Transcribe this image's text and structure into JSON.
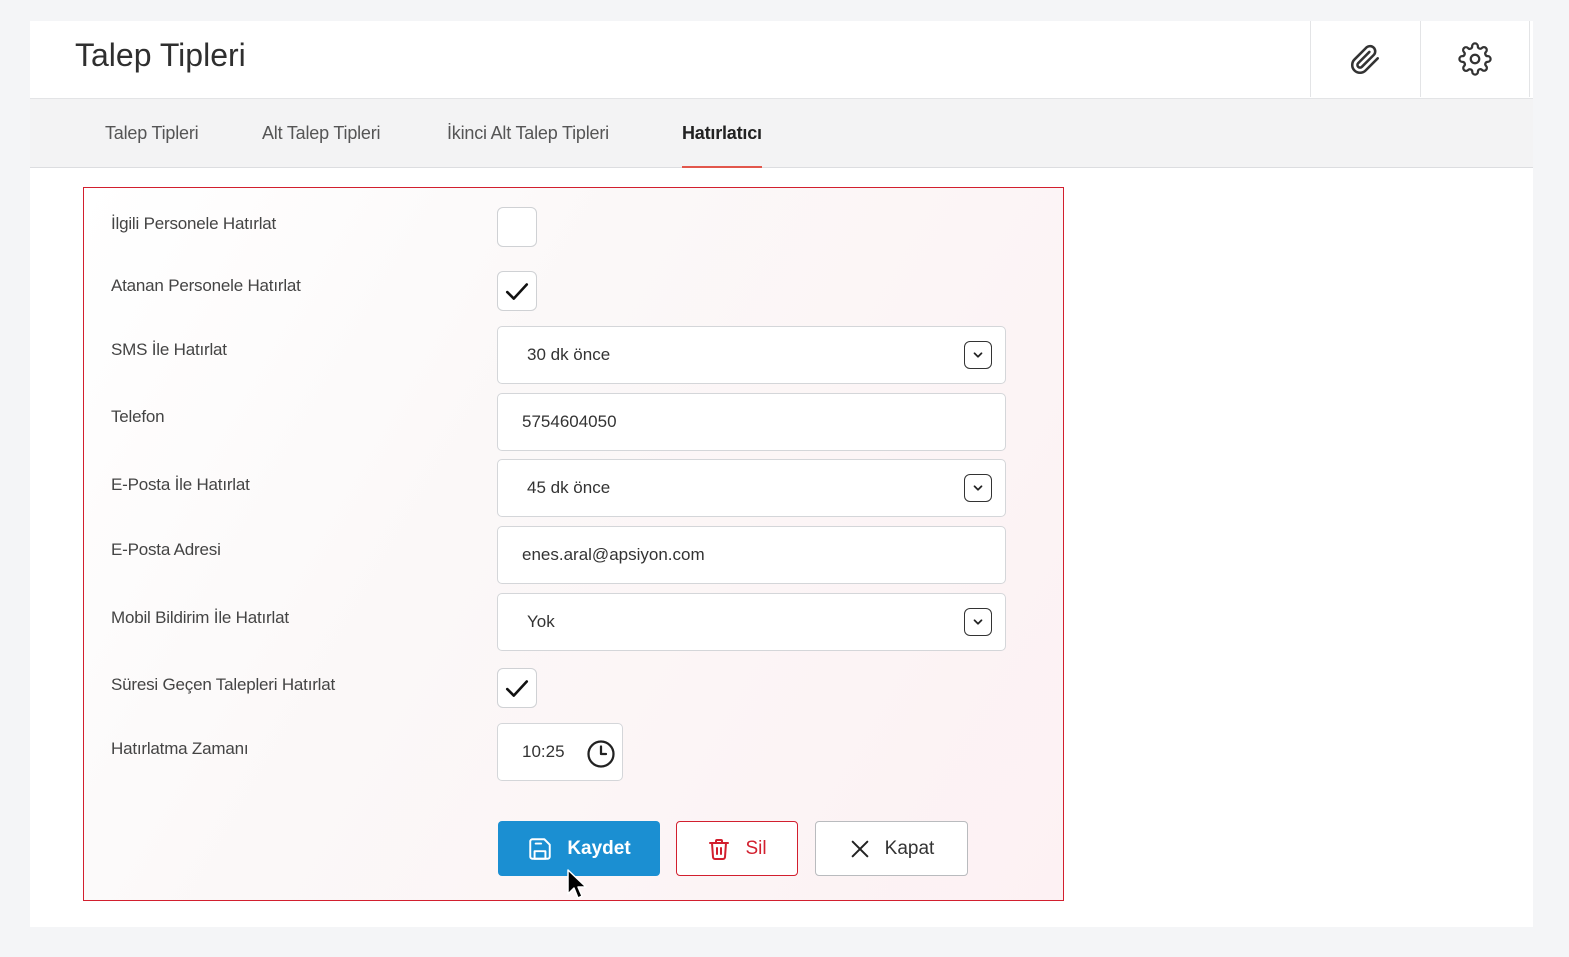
{
  "header": {
    "title": "Talep Tipleri",
    "attach_icon": "paperclip-icon",
    "settings_icon": "gear-icon"
  },
  "tabs": [
    {
      "label": "Talep Tipleri",
      "active": false
    },
    {
      "label": "Alt Talep Tipleri",
      "active": false
    },
    {
      "label": "İkinci Alt Talep Tipleri",
      "active": false
    },
    {
      "label": "Hatırlatıcı",
      "active": true
    }
  ],
  "form": {
    "related_staff": {
      "label": "İlgili Personele Hatırlat",
      "checked": false
    },
    "assigned_staff": {
      "label": "Atanan Personele Hatırlat",
      "checked": true
    },
    "sms": {
      "label": "SMS İle Hatırlat",
      "value": "30 dk önce"
    },
    "phone": {
      "label": "Telefon",
      "value": "5754604050"
    },
    "email_remind": {
      "label": "E-Posta İle Hatırlat",
      "value": "45 dk önce"
    },
    "email_address": {
      "label": "E-Posta Adresi",
      "value": "enes.aral@apsiyon.com"
    },
    "mobile": {
      "label": "Mobil Bildirim İle Hatırlat",
      "value": "Yok"
    },
    "overdue": {
      "label": "Süresi Geçen Talepleri Hatırlat",
      "checked": true
    },
    "time": {
      "label": "Hatırlatma Zamanı",
      "value": "10:25"
    }
  },
  "buttons": {
    "save": "Kaydet",
    "delete": "Sil",
    "close": "Kapat"
  },
  "colors": {
    "primary": "#1b8fd2",
    "danger": "#d21f2e",
    "tab_indicator": "#e2574c"
  }
}
